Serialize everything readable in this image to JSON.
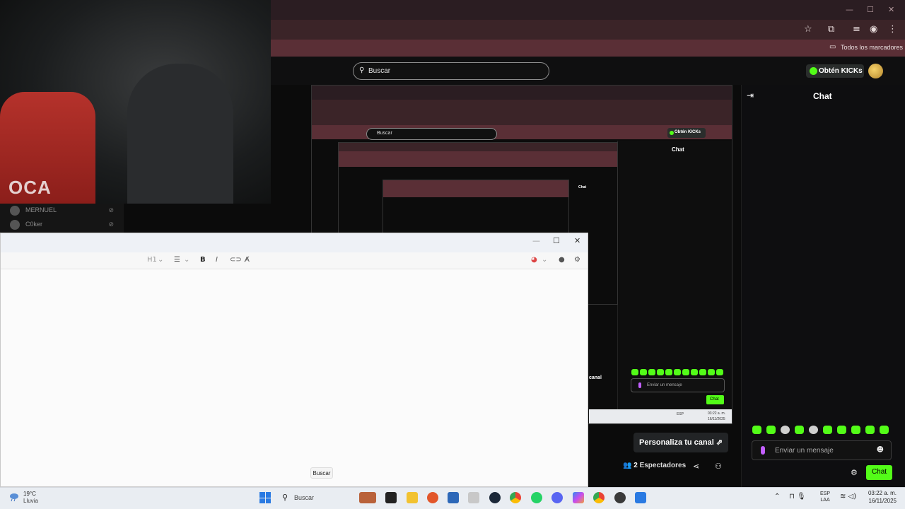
{
  "browser": {
    "bookmarks_label": "Todos los marcadores",
    "window_controls": {
      "minimize": "—",
      "maximize": "☐",
      "close": "✕"
    },
    "toolbar_icons": [
      "star-icon",
      "extensions-icon",
      "media-icon",
      "profile-icon",
      "menu-icon"
    ]
  },
  "kick": {
    "search_placeholder": "Buscar",
    "kicks_button": "Obtén KICKs",
    "chat_title": "Chat",
    "message_placeholder": "Enviar un mensaje",
    "chat_button": "Chat",
    "customize_button": "Personaliza tu canal",
    "viewers_count": "2",
    "viewers_label": "Espectadores"
  },
  "nested_stream": {
    "search": "Buscar",
    "kicks_button": "Obtén KICKs",
    "chat_title": "Chat",
    "message_placeholder": "Enviar un mensaje",
    "chat_button": "Chat",
    "customize_button": "canal",
    "tray_lang": "ESP",
    "clock": "03:22 a. m.",
    "date": "16/11/2025"
  },
  "voice_users": [
    {
      "name": "MERNUEL"
    },
    {
      "name": "C0ker"
    }
  ],
  "webcam": {
    "shirt_text": "OCA"
  },
  "editor": {
    "heading_label": "H1",
    "tooltip": "Buscar"
  },
  "taskbar": {
    "weather_temp": "19°C",
    "weather_desc": "Lluvia",
    "search_placeholder": "Buscar",
    "lang_top": "ESP",
    "lang_bottom": "LAA",
    "time": "03:22 a. m.",
    "date": "16/11/2025"
  },
  "colors": {
    "kick_green": "#53fc18",
    "browser_dark": "#2b1d22",
    "browser_mid": "#3b2428",
    "browser_bookmarks": "#5a2f36"
  }
}
